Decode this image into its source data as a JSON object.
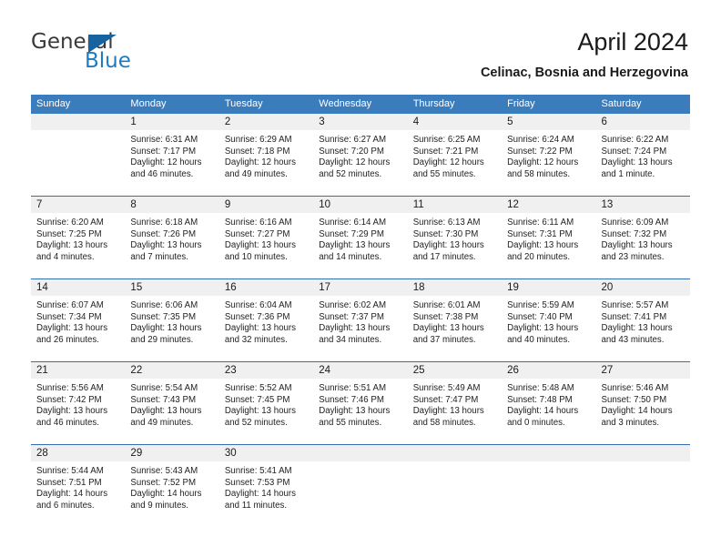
{
  "brand": {
    "name_part1": "General",
    "name_part2": "Blue",
    "triangle_icon": "blue-triangle-icon"
  },
  "header": {
    "title": "April 2024",
    "subtitle": "Celinac, Bosnia and Herzegovina"
  },
  "colors": {
    "header_blue": "#3b7cbd",
    "separator_blue": "#2f6fb2",
    "day_band_gray": "#f0f0f0",
    "logo_blue": "#1f7bc1"
  },
  "calendar": {
    "weekday_headers": [
      "Sunday",
      "Monday",
      "Tuesday",
      "Wednesday",
      "Thursday",
      "Friday",
      "Saturday"
    ],
    "weeks": [
      [
        {
          "day": "",
          "lines": []
        },
        {
          "day": "1",
          "lines": [
            "Sunrise: 6:31 AM",
            "Sunset: 7:17 PM",
            "Daylight: 12 hours",
            "and 46 minutes."
          ]
        },
        {
          "day": "2",
          "lines": [
            "Sunrise: 6:29 AM",
            "Sunset: 7:18 PM",
            "Daylight: 12 hours",
            "and 49 minutes."
          ]
        },
        {
          "day": "3",
          "lines": [
            "Sunrise: 6:27 AM",
            "Sunset: 7:20 PM",
            "Daylight: 12 hours",
            "and 52 minutes."
          ]
        },
        {
          "day": "4",
          "lines": [
            "Sunrise: 6:25 AM",
            "Sunset: 7:21 PM",
            "Daylight: 12 hours",
            "and 55 minutes."
          ]
        },
        {
          "day": "5",
          "lines": [
            "Sunrise: 6:24 AM",
            "Sunset: 7:22 PM",
            "Daylight: 12 hours",
            "and 58 minutes."
          ]
        },
        {
          "day": "6",
          "lines": [
            "Sunrise: 6:22 AM",
            "Sunset: 7:24 PM",
            "Daylight: 13 hours",
            "and 1 minute."
          ]
        }
      ],
      [
        {
          "day": "7",
          "lines": [
            "Sunrise: 6:20 AM",
            "Sunset: 7:25 PM",
            "Daylight: 13 hours",
            "and 4 minutes."
          ]
        },
        {
          "day": "8",
          "lines": [
            "Sunrise: 6:18 AM",
            "Sunset: 7:26 PM",
            "Daylight: 13 hours",
            "and 7 minutes."
          ]
        },
        {
          "day": "9",
          "lines": [
            "Sunrise: 6:16 AM",
            "Sunset: 7:27 PM",
            "Daylight: 13 hours",
            "and 10 minutes."
          ]
        },
        {
          "day": "10",
          "lines": [
            "Sunrise: 6:14 AM",
            "Sunset: 7:29 PM",
            "Daylight: 13 hours",
            "and 14 minutes."
          ]
        },
        {
          "day": "11",
          "lines": [
            "Sunrise: 6:13 AM",
            "Sunset: 7:30 PM",
            "Daylight: 13 hours",
            "and 17 minutes."
          ]
        },
        {
          "day": "12",
          "lines": [
            "Sunrise: 6:11 AM",
            "Sunset: 7:31 PM",
            "Daylight: 13 hours",
            "and 20 minutes."
          ]
        },
        {
          "day": "13",
          "lines": [
            "Sunrise: 6:09 AM",
            "Sunset: 7:32 PM",
            "Daylight: 13 hours",
            "and 23 minutes."
          ]
        }
      ],
      [
        {
          "day": "14",
          "lines": [
            "Sunrise: 6:07 AM",
            "Sunset: 7:34 PM",
            "Daylight: 13 hours",
            "and 26 minutes."
          ]
        },
        {
          "day": "15",
          "lines": [
            "Sunrise: 6:06 AM",
            "Sunset: 7:35 PM",
            "Daylight: 13 hours",
            "and 29 minutes."
          ]
        },
        {
          "day": "16",
          "lines": [
            "Sunrise: 6:04 AM",
            "Sunset: 7:36 PM",
            "Daylight: 13 hours",
            "and 32 minutes."
          ]
        },
        {
          "day": "17",
          "lines": [
            "Sunrise: 6:02 AM",
            "Sunset: 7:37 PM",
            "Daylight: 13 hours",
            "and 34 minutes."
          ]
        },
        {
          "day": "18",
          "lines": [
            "Sunrise: 6:01 AM",
            "Sunset: 7:38 PM",
            "Daylight: 13 hours",
            "and 37 minutes."
          ]
        },
        {
          "day": "19",
          "lines": [
            "Sunrise: 5:59 AM",
            "Sunset: 7:40 PM",
            "Daylight: 13 hours",
            "and 40 minutes."
          ]
        },
        {
          "day": "20",
          "lines": [
            "Sunrise: 5:57 AM",
            "Sunset: 7:41 PM",
            "Daylight: 13 hours",
            "and 43 minutes."
          ]
        }
      ],
      [
        {
          "day": "21",
          "lines": [
            "Sunrise: 5:56 AM",
            "Sunset: 7:42 PM",
            "Daylight: 13 hours",
            "and 46 minutes."
          ]
        },
        {
          "day": "22",
          "lines": [
            "Sunrise: 5:54 AM",
            "Sunset: 7:43 PM",
            "Daylight: 13 hours",
            "and 49 minutes."
          ]
        },
        {
          "day": "23",
          "lines": [
            "Sunrise: 5:52 AM",
            "Sunset: 7:45 PM",
            "Daylight: 13 hours",
            "and 52 minutes."
          ]
        },
        {
          "day": "24",
          "lines": [
            "Sunrise: 5:51 AM",
            "Sunset: 7:46 PM",
            "Daylight: 13 hours",
            "and 55 minutes."
          ]
        },
        {
          "day": "25",
          "lines": [
            "Sunrise: 5:49 AM",
            "Sunset: 7:47 PM",
            "Daylight: 13 hours",
            "and 58 minutes."
          ]
        },
        {
          "day": "26",
          "lines": [
            "Sunrise: 5:48 AM",
            "Sunset: 7:48 PM",
            "Daylight: 14 hours",
            "and 0 minutes."
          ]
        },
        {
          "day": "27",
          "lines": [
            "Sunrise: 5:46 AM",
            "Sunset: 7:50 PM",
            "Daylight: 14 hours",
            "and 3 minutes."
          ]
        }
      ],
      [
        {
          "day": "28",
          "lines": [
            "Sunrise: 5:44 AM",
            "Sunset: 7:51 PM",
            "Daylight: 14 hours",
            "and 6 minutes."
          ]
        },
        {
          "day": "29",
          "lines": [
            "Sunrise: 5:43 AM",
            "Sunset: 7:52 PM",
            "Daylight: 14 hours",
            "and 9 minutes."
          ]
        },
        {
          "day": "30",
          "lines": [
            "Sunrise: 5:41 AM",
            "Sunset: 7:53 PM",
            "Daylight: 14 hours",
            "and 11 minutes."
          ]
        },
        {
          "day": "",
          "lines": []
        },
        {
          "day": "",
          "lines": []
        },
        {
          "day": "",
          "lines": []
        },
        {
          "day": "",
          "lines": []
        }
      ]
    ]
  }
}
